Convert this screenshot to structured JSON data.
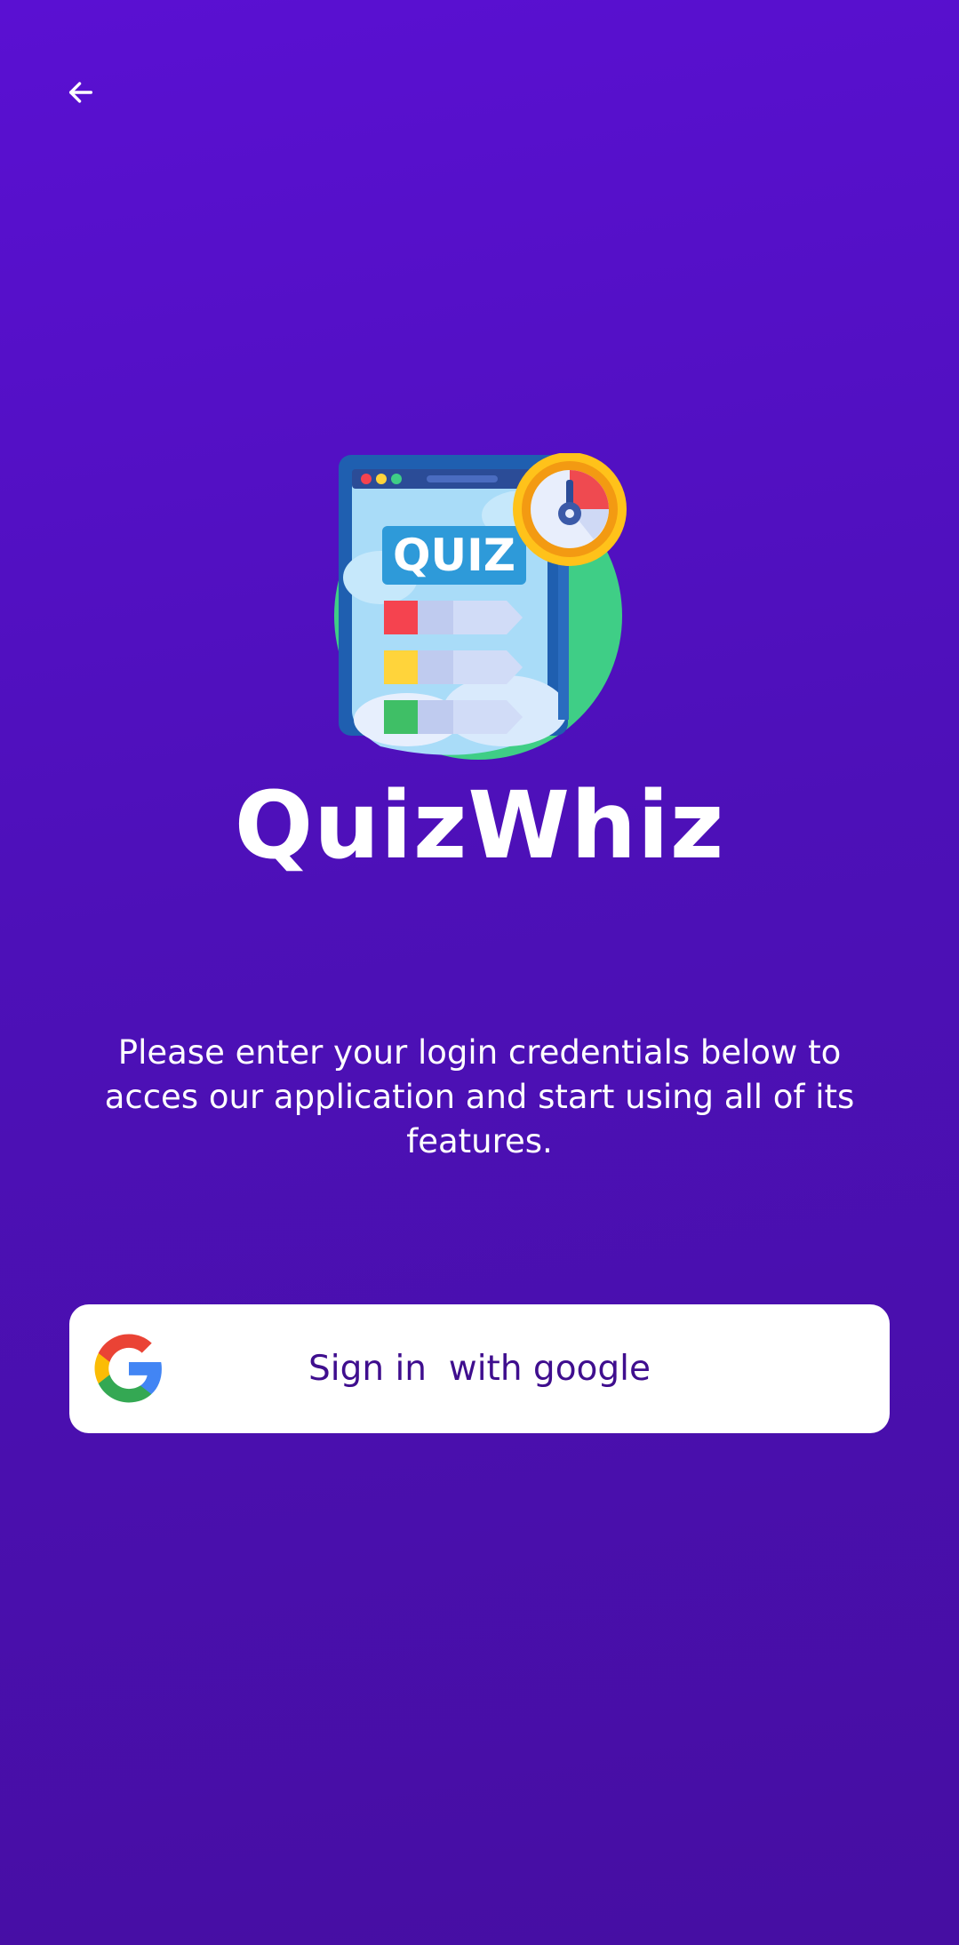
{
  "header": {
    "back_icon": "arrow-left-icon"
  },
  "logo": {
    "badge_text": "QUIZ",
    "icon": "quiz-document-timer-icon"
  },
  "app": {
    "title": "QuizWhiz"
  },
  "login": {
    "description": "Please enter your login credentials below to acces our application and start using all of its features.",
    "google_button_label": "Sign in  with google",
    "google_icon": "google-g-icon"
  },
  "colors": {
    "background_top": "#5a10d2",
    "background_bottom": "#460ea2",
    "button_background": "#ffffff",
    "button_text": "#3f0e8e"
  }
}
